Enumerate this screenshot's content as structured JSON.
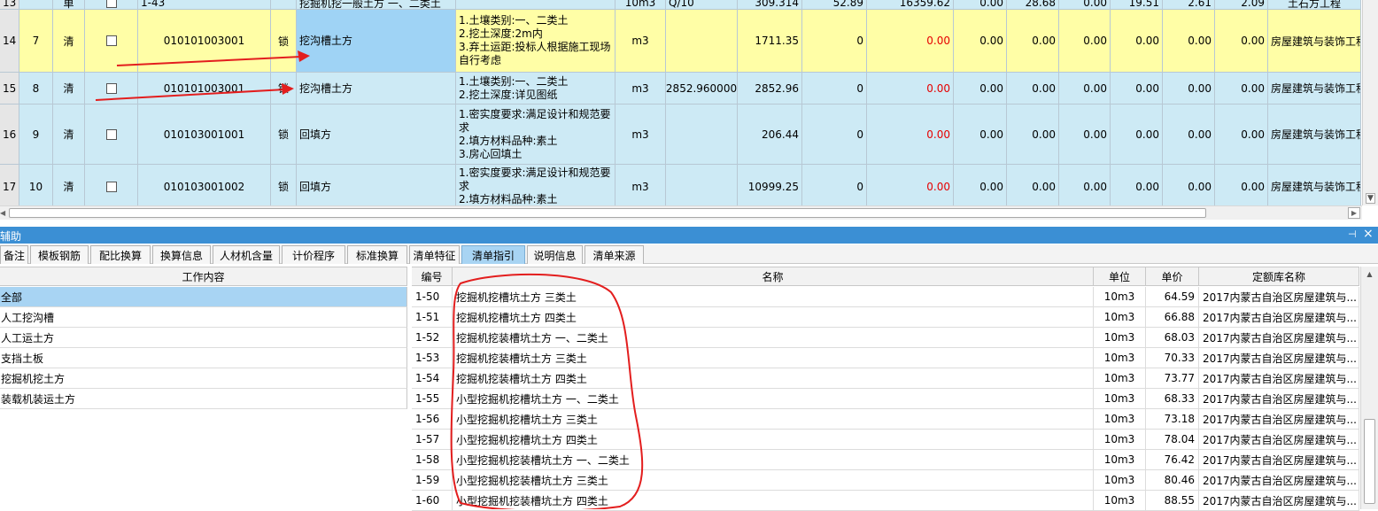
{
  "top_grid": {
    "partial_row": {
      "row_no": "13",
      "kind": "单",
      "code": "1-43",
      "name": "挖掘机挖一般土方 一、二类土",
      "unit": "10m3",
      "qty": "Q/10",
      "v1": "309.314",
      "v2": "52.89",
      "v3": "16359.62",
      "v4": "0.00",
      "v5": "28.68",
      "v6": "0.00",
      "v7": "19.51",
      "v8": "2.61",
      "v9": "2.09",
      "category": "土石方工程"
    },
    "rows": [
      {
        "row_no": "14",
        "seq": "7",
        "kind": "清",
        "code": "010101003001",
        "lock": "锁",
        "name": "挖沟槽土方",
        "desc": "1.土壤类别:一、二类土\n2.挖土深度:2m内\n3.弃土运距:投标人根据施工现场自行考虑",
        "unit": "m3",
        "qty": "",
        "amount": "1711.35",
        "v1": "0",
        "v2": "0.00",
        "v3": "0.00",
        "v4": "0.00",
        "v5": "0.00",
        "v6": "0.00",
        "v7": "0.00",
        "v8": "0.00",
        "category": "房屋建筑与装饰工程"
      },
      {
        "row_no": "15",
        "seq": "8",
        "kind": "清",
        "code": "010101003001",
        "lock": "锁",
        "name": "挖沟槽土方",
        "desc": "1.土壤类别:一、二类土\n2.挖土深度:详见图纸",
        "unit": "m3",
        "qty": "2852.960000",
        "amount": "2852.96",
        "v1": "0",
        "v2": "0.00",
        "v3": "0.00",
        "v4": "0.00",
        "v5": "0.00",
        "v6": "0.00",
        "v7": "0.00",
        "v8": "0.00",
        "category": "房屋建筑与装饰工程"
      },
      {
        "row_no": "16",
        "seq": "9",
        "kind": "清",
        "code": "010103001001",
        "lock": "锁",
        "name": "回填方",
        "desc": "1.密实度要求:满足设计和规范要求\n2.填方材料品种:素土\n3.房心回填土",
        "unit": "m3",
        "qty": "",
        "amount": "206.44",
        "v1": "0",
        "v2": "0.00",
        "v3": "0.00",
        "v4": "0.00",
        "v5": "0.00",
        "v6": "0.00",
        "v7": "0.00",
        "v8": "0.00",
        "category": "房屋建筑与装饰工程"
      },
      {
        "row_no": "17",
        "seq": "10",
        "kind": "清",
        "code": "010103001002",
        "lock": "锁",
        "name": "回填方",
        "desc": "1.密实度要求:满足设计和规范要求\n2.填方材料品种:素土",
        "unit": "m3",
        "qty": "",
        "amount": "10999.25",
        "v1": "0",
        "v2": "0.00",
        "v3": "0.00",
        "v4": "0.00",
        "v5": "0.00",
        "v6": "0.00",
        "v7": "0.00",
        "v8": "0.00",
        "category": "房屋建筑与装饰工程"
      }
    ]
  },
  "panel": {
    "title": "辅助",
    "pin_icon": "pin-icon",
    "close_icon": "close-icon",
    "tabs": [
      "备注",
      "模板钢筋",
      "配比换算",
      "换算信息",
      "人材机含量",
      "计价程序",
      "标准换算",
      "清单特征",
      "清单指引",
      "说明信息",
      "清单来源"
    ],
    "active_tab": "清单指引"
  },
  "work_content": {
    "header": "工作内容",
    "items": [
      "全部",
      "人工挖沟槽",
      "人工运土方",
      "支挡土板",
      "挖掘机挖土方",
      "装载机装运土方"
    ],
    "selected": "全部"
  },
  "quota_table": {
    "headers": {
      "code": "编号",
      "name": "名称",
      "unit": "单位",
      "price": "单价",
      "library": "定额库名称"
    },
    "rows": [
      {
        "code": "1-50",
        "name": "挖掘机挖槽坑土方 三类土",
        "unit": "10m3",
        "price": "64.59",
        "library": "2017内蒙古自治区房屋建筑与..."
      },
      {
        "code": "1-51",
        "name": "挖掘机挖槽坑土方 四类土",
        "unit": "10m3",
        "price": "66.88",
        "library": "2017内蒙古自治区房屋建筑与..."
      },
      {
        "code": "1-52",
        "name": "挖掘机挖装槽坑土方 一、二类土",
        "unit": "10m3",
        "price": "68.03",
        "library": "2017内蒙古自治区房屋建筑与..."
      },
      {
        "code": "1-53",
        "name": "挖掘机挖装槽坑土方 三类土",
        "unit": "10m3",
        "price": "70.33",
        "library": "2017内蒙古自治区房屋建筑与..."
      },
      {
        "code": "1-54",
        "name": "挖掘机挖装槽坑土方 四类土",
        "unit": "10m3",
        "price": "73.77",
        "library": "2017内蒙古自治区房屋建筑与..."
      },
      {
        "code": "1-55",
        "name": "小型挖掘机挖槽坑土方 一、二类土",
        "unit": "10m3",
        "price": "68.33",
        "library": "2017内蒙古自治区房屋建筑与..."
      },
      {
        "code": "1-56",
        "name": "小型挖掘机挖槽坑土方 三类土",
        "unit": "10m3",
        "price": "73.18",
        "library": "2017内蒙古自治区房屋建筑与..."
      },
      {
        "code": "1-57",
        "name": "小型挖掘机挖槽坑土方 四类土",
        "unit": "10m3",
        "price": "78.04",
        "library": "2017内蒙古自治区房屋建筑与..."
      },
      {
        "code": "1-58",
        "name": "小型挖掘机挖装槽坑土方 一、二类土",
        "unit": "10m3",
        "price": "76.42",
        "library": "2017内蒙古自治区房屋建筑与..."
      },
      {
        "code": "1-59",
        "name": "小型挖掘机挖装槽坑土方 三类土",
        "unit": "10m3",
        "price": "80.46",
        "library": "2017内蒙古自治区房屋建筑与..."
      },
      {
        "code": "1-60",
        "name": "小型挖掘机挖装槽坑土方 四类土",
        "unit": "10m3",
        "price": "88.55",
        "library": "2017内蒙古自治区房屋建筑与..."
      }
    ]
  },
  "colors": {
    "panel_title_bg": "#3b8fd4",
    "active_tab_bg": "#a8d4f3",
    "yellow_row": "#fffea6",
    "grid_row": "#cdeaf5",
    "annotation_red": "#e31e1e",
    "zero_red": "#e60000"
  }
}
